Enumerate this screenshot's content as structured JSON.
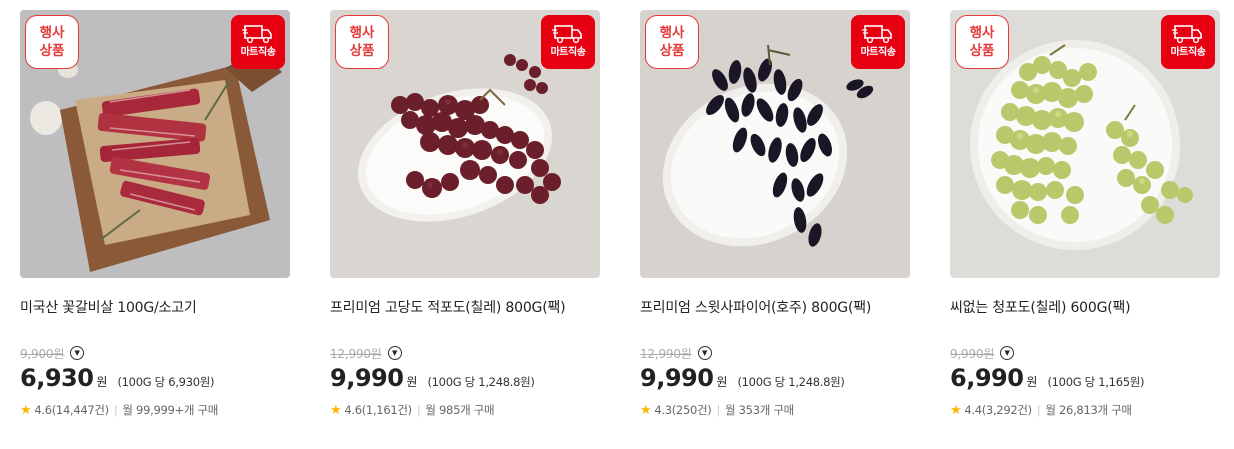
{
  "products": [
    {
      "event_line1": "행사",
      "event_line2": "상품",
      "mart_label": "마트직송",
      "name": "미국산 꽃갈비살 100G/소고기",
      "original_price": "9,900원",
      "price": "6,930",
      "currency": "원",
      "unit_price": "(100G 당 6,930원)",
      "rating": "4.6(14,447건)",
      "monthly": "월 99,999+개 구매",
      "image": "beef-image"
    },
    {
      "event_line1": "행사",
      "event_line2": "상품",
      "mart_label": "마트직송",
      "name": "프리미엄 고당도 적포도(칠레) 800G(팩)",
      "original_price": "12,990원",
      "price": "9,990",
      "currency": "원",
      "unit_price": "(100G 당 1,248.8원)",
      "rating": "4.6(1,161건)",
      "monthly": "월 985개 구매",
      "image": "red-grape-image"
    },
    {
      "event_line1": "행사",
      "event_line2": "상품",
      "mart_label": "마트직송",
      "name": "프리미엄 스윗사파이어(호주) 800G(팩)",
      "original_price": "12,990원",
      "price": "9,990",
      "currency": "원",
      "unit_price": "(100G 당 1,248.8원)",
      "rating": "4.3(250건)",
      "monthly": "월 353개 구매",
      "image": "sweet-sapphire-grape-image"
    },
    {
      "event_line1": "행사",
      "event_line2": "상품",
      "mart_label": "마트직송",
      "name": "씨없는 청포도(칠레) 600G(팩)",
      "original_price": "9,990원",
      "price": "6,990",
      "currency": "원",
      "unit_price": "(100G 당 1,165원)",
      "rating": "4.4(3,292건)",
      "monthly": "월 26,813개 구매",
      "image": "green-grape-image"
    }
  ],
  "colors": {
    "accent_red": "#e60012",
    "star": "#ffb400"
  }
}
